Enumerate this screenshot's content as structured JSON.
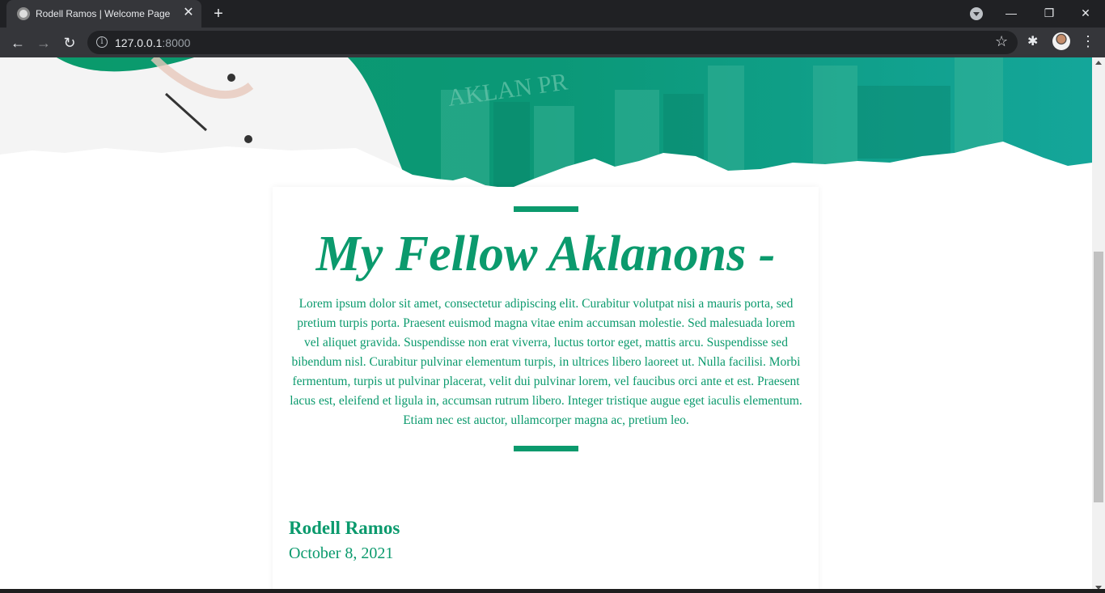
{
  "browser": {
    "tab_title": "Rodell Ramos | Welcome Page",
    "tab_close": "✕",
    "new_tab": "+",
    "url_host": "127.0.0.1",
    "url_port": ":8000",
    "back": "←",
    "forward": "→",
    "reload": "↻",
    "star": "☆",
    "extensions": "✱",
    "menu": "⋮",
    "minimize": "—",
    "restore": "❐",
    "close": "✕"
  },
  "page": {
    "heading": "My Fellow Aklanons -",
    "body": "Lorem ipsum dolor sit amet, consectetur adipiscing elit. Curabitur volutpat nisi a mauris porta, sed pretium turpis porta. Praesent euismod magna vitae enim accumsan molestie. Sed malesuada lorem vel aliquet gravida. Suspendisse non erat viverra, luctus tortor eget, mattis arcu. Suspendisse sed bibendum nisl. Curabitur pulvinar elementum turpis, in ultrices libero laoreet ut. Nulla facilisi. Morbi fermentum, turpis ut pulvinar placerat, velit dui pulvinar lorem, vel faucibus orci ante et est. Praesent lacus est, eleifend et ligula in, accumsan rutrum libero. Integer tristique augue eget iaculis elementum. Etiam nec est auctor, ullamcorper magna ac, pretium leo.",
    "author": "Rodell Ramos",
    "date": "October 8, 2021",
    "hero_building_text": "AKLAN PR"
  },
  "colors": {
    "accent": "#0b9a6d",
    "chrome_dark": "#202124",
    "chrome_toolbar": "#35363a"
  },
  "icons": [
    "info-icon",
    "star-icon",
    "puzzle-icon",
    "kebab-menu-icon",
    "back-arrow-icon",
    "forward-arrow-icon",
    "reload-icon"
  ]
}
